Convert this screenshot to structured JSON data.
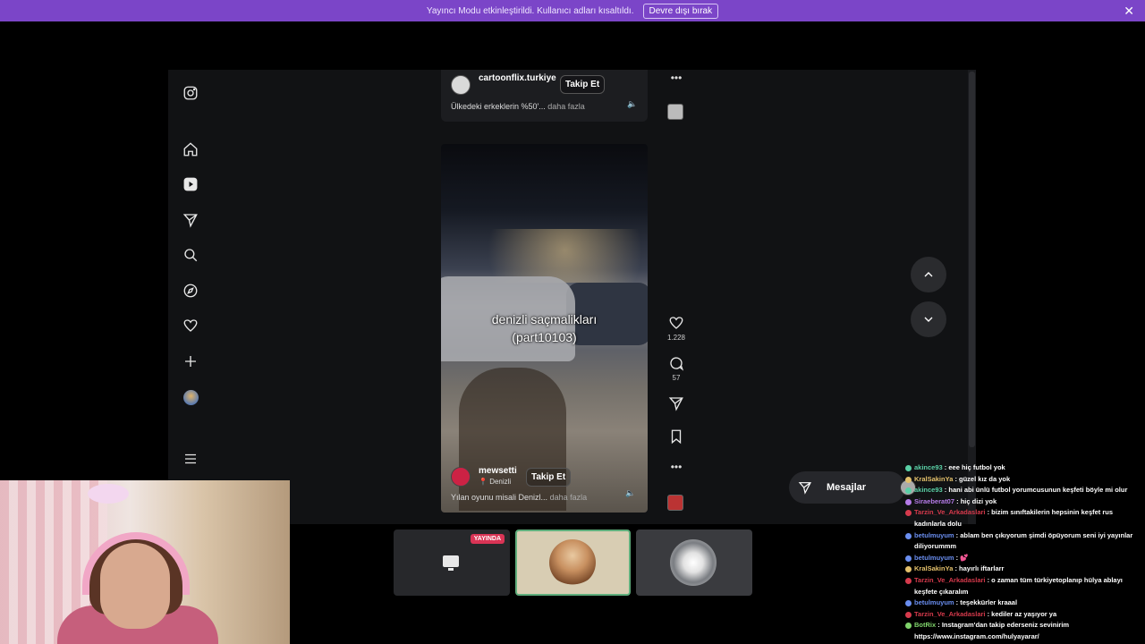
{
  "banner": {
    "message": "Yayıncı Modu etkinleştirildi. Kullanıcı adları kısaltıldı.",
    "button_label": "Devre dışı bırak",
    "close_glyph": "✕"
  },
  "reel_top": {
    "username": "cartoonflix.turkiye",
    "follow_label": "Takip Et",
    "caption": "Ülkedeki erkeklerin %50'...",
    "more_label": "daha fazla"
  },
  "reel_main": {
    "overlay_line1": "denizli saçmalikları",
    "overlay_line2": "(part10103)",
    "username": "mewsetti",
    "location": "Denizli",
    "follow_label": "Takip Et",
    "caption": "Yılan oyunu misali Denizl...",
    "more_label": "daha fazla",
    "likes": "1.228",
    "comments": "57"
  },
  "messages_label": "Mesajlar",
  "tiles": {
    "live_label": "YAYINDA"
  },
  "chat": [
    {
      "name": "akince93",
      "text": "eee hiç futbol yok",
      "color": "#5ad0a6"
    },
    {
      "name": "KralSakinYa",
      "text": "güzel kız da yok",
      "color": "#e3c06b"
    },
    {
      "name": "akince93",
      "text": "hani abi ünlü futbol yorumcusunun keşfeti böyle mi olur",
      "color": "#5ad0a6"
    },
    {
      "name": "Siraeberat07",
      "text": "hiç dizi yok",
      "color": "#b57be8"
    },
    {
      "name": "Tarzin_Ve_Arkadaslari",
      "text": "bizim sınıftakilerin hepsinin keşfet rus kadınlarla dolu",
      "color": "#d63a4c"
    },
    {
      "name": "betulmuyum",
      "text": "ablam ben çıkıyorum şimdi öpüyorum seni iyi yayınlar diliyorummm",
      "color": "#6a8ef0"
    },
    {
      "name": "betulmuyum",
      "text": "💕",
      "color": "#6a8ef0"
    },
    {
      "name": "KralSakinYa",
      "text": "hayırlı iftarlarr",
      "color": "#e3c06b"
    },
    {
      "name": "Tarzin_Ve_Arkadaslari",
      "text": "o zaman tüm türkiyetoplanıp hülya ablayı keşfete çıkaralım",
      "color": "#d63a4c"
    },
    {
      "name": "betulmuyum",
      "text": "teşekkürler kraaal",
      "color": "#6a8ef0"
    },
    {
      "name": "Tarzin_Ve_Arkadaslari",
      "text": "kediler az yaşıyor ya",
      "color": "#d63a4c"
    },
    {
      "name": "BotRix",
      "text": "Instagram'dan takip ederseniz sevinirim https://www.instagram.com/hulyayarar/",
      "color": "#7fd36b"
    }
  ],
  "colors": {
    "banner": "#7b45c8",
    "live_badge": "#d93455",
    "active_tile_border": "#5fae7c"
  },
  "icons": [
    "instagram-icon",
    "home-icon",
    "reels-icon",
    "send-icon",
    "search-icon",
    "explore-icon",
    "heart-icon",
    "plus-icon",
    "profile-avatar",
    "menu-icon"
  ]
}
